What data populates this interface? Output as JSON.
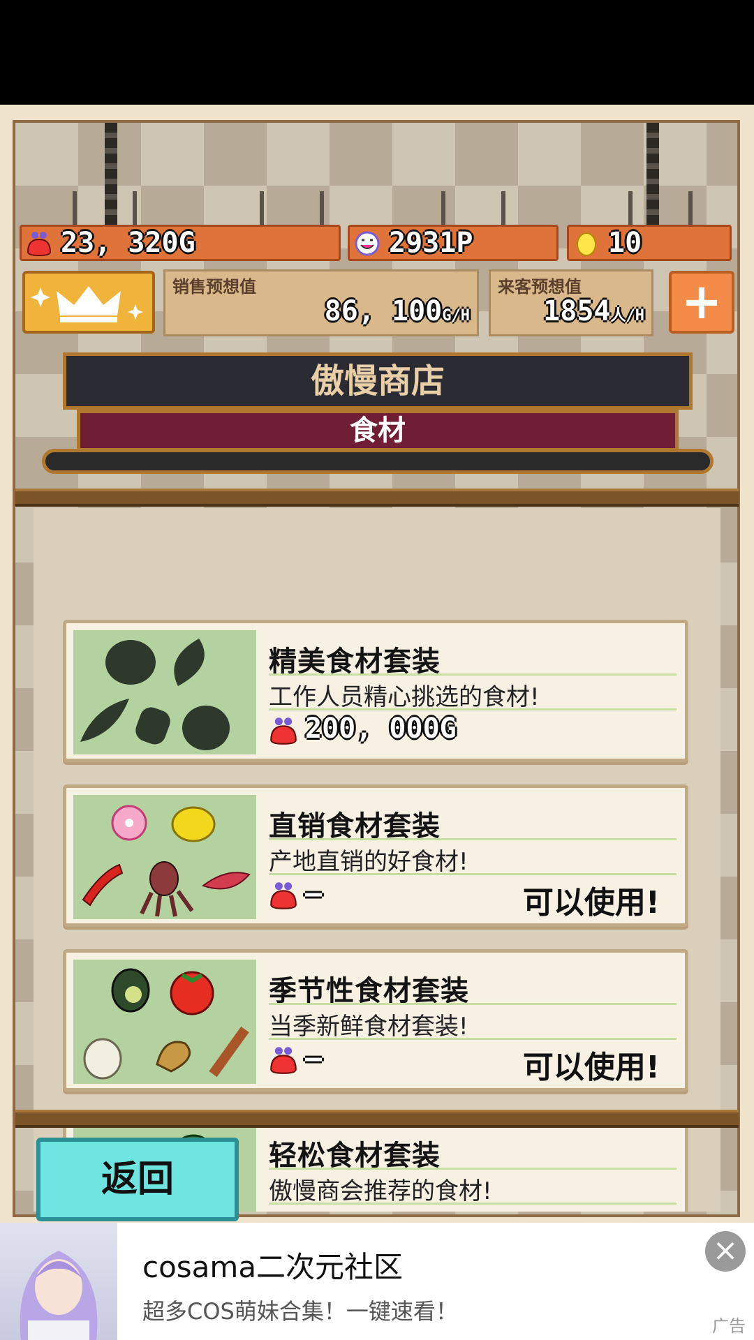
{
  "hud": {
    "gold": "23, 320G",
    "points": "2931P",
    "eggs": "10"
  },
  "forecast": {
    "sales_label": "销售预想值",
    "sales_value": "86, 100",
    "sales_unit": "G/H",
    "visitors_label": "来客预想值",
    "visitors_value": "1854",
    "visitors_unit": "人/H"
  },
  "shop": {
    "name": "傲慢商店",
    "category": "食材"
  },
  "items": [
    {
      "title": "精美食材套装",
      "desc": "工作人员精心挑选的食材!",
      "price": "200, 000G",
      "status": ""
    },
    {
      "title": "直销食材套装",
      "desc": "产地直销的好食材!",
      "price": "–",
      "status": "可以使用!"
    },
    {
      "title": "季节性食材套装",
      "desc": "当季新鲜食材套装!",
      "price": "–",
      "status": "可以使用!"
    },
    {
      "title": "轻松食材套装",
      "desc": "傲慢商会推荐的食材!",
      "price": "",
      "status": ""
    }
  ],
  "back_label": "返回",
  "ad": {
    "title": "cosama二次元社区",
    "subtitle": "超多COS萌妹合集！一键速看！",
    "label": "广告",
    "close": "×"
  },
  "colors": {
    "accent_orange": "#e0733a",
    "banner_red": "#6f1e34",
    "back_button": "#6ee5e0",
    "food_panel": "#b4d2a0"
  }
}
